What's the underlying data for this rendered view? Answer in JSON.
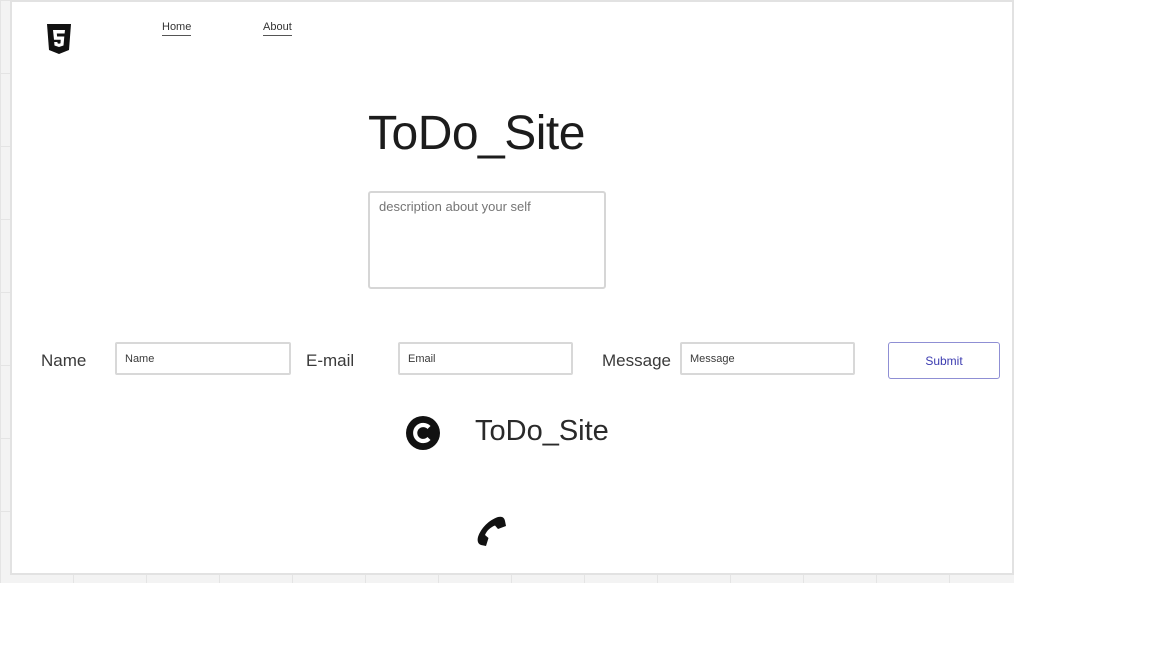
{
  "nav": {
    "logo_icon": "html5-icon",
    "items": [
      {
        "label": "Home"
      },
      {
        "label": "About"
      }
    ]
  },
  "main": {
    "title": "ToDo_Site",
    "description_placeholder": "description about your self"
  },
  "form": {
    "name_label": "Name",
    "name_placeholder": "Name",
    "email_label": "E-mail",
    "email_placeholder": "Email",
    "message_label": "Message",
    "message_placeholder": "Message",
    "submit_label": "Submit"
  },
  "footer": {
    "copyright_icon": "copyright-icon",
    "title": "ToDo_Site",
    "phone_icon": "phone-icon"
  },
  "colors": {
    "text": "#1c1c1c",
    "submit_text": "#3b3bb0",
    "submit_border": "#8f8fd4",
    "input_border": "#d8d8d8"
  }
}
